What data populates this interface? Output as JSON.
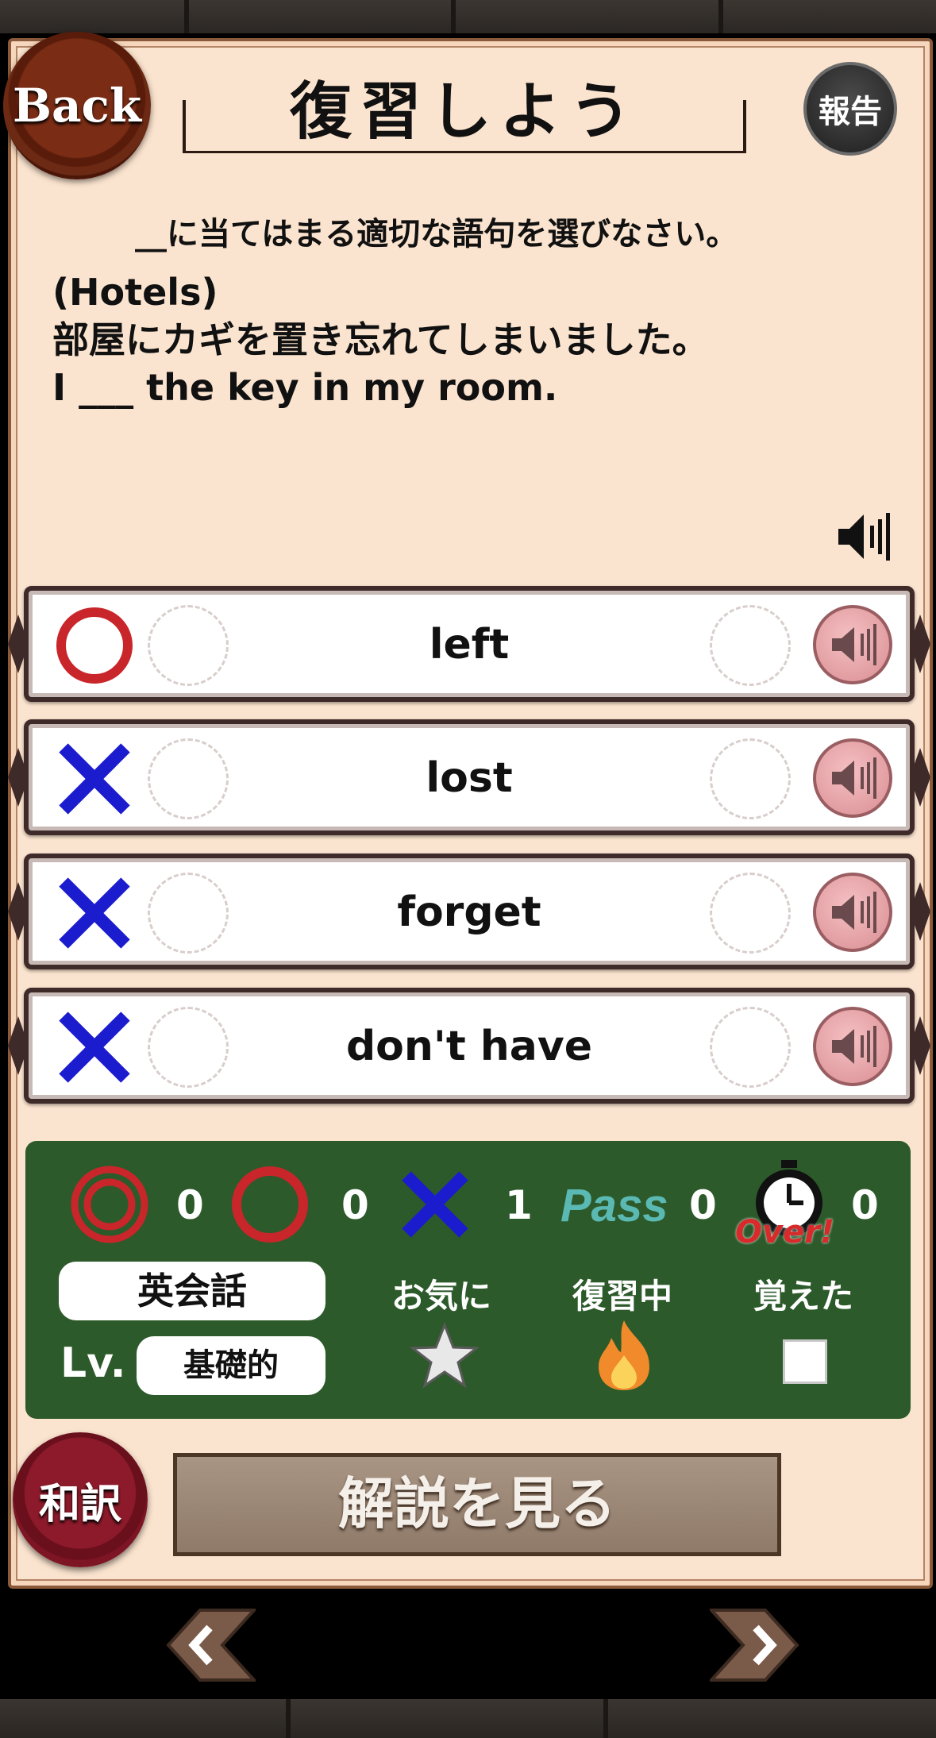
{
  "header": {
    "back_label": "Back",
    "title": "復習しよう",
    "report_label": "報告"
  },
  "question": {
    "instruction": "__に当てはまる適切な語句を選びなさい。",
    "lines": [
      "(Hotels)",
      "部屋にカギを置き忘れてしまいました。",
      "I ___ the key in my room."
    ]
  },
  "answers": [
    {
      "label": "left",
      "mark": "circle-icon"
    },
    {
      "label": "lost",
      "mark": "cross-icon"
    },
    {
      "label": "forget",
      "mark": "cross-icon"
    },
    {
      "label": "don't have",
      "mark": "cross-icon"
    }
  ],
  "stats": {
    "double_circle_count": "0",
    "circle_count": "0",
    "cross_count": "1",
    "pass_label": "Pass",
    "pass_count": "0",
    "timeover_label": "Over!",
    "timeover_count": "0",
    "category": "英会話",
    "lv_label": "Lv.",
    "level": "基礎的",
    "favorite_label": "お気に",
    "reviewing_label": "復習中",
    "memorized_label": "覚えた"
  },
  "footer": {
    "translate_label": "和訳",
    "explain_label": "解説を見る"
  },
  "colors": {
    "parchment": "#fbe4cf",
    "correct": "#c8262a",
    "wrong": "#1c1ccf",
    "stats_bg": "#2c5a2a"
  }
}
